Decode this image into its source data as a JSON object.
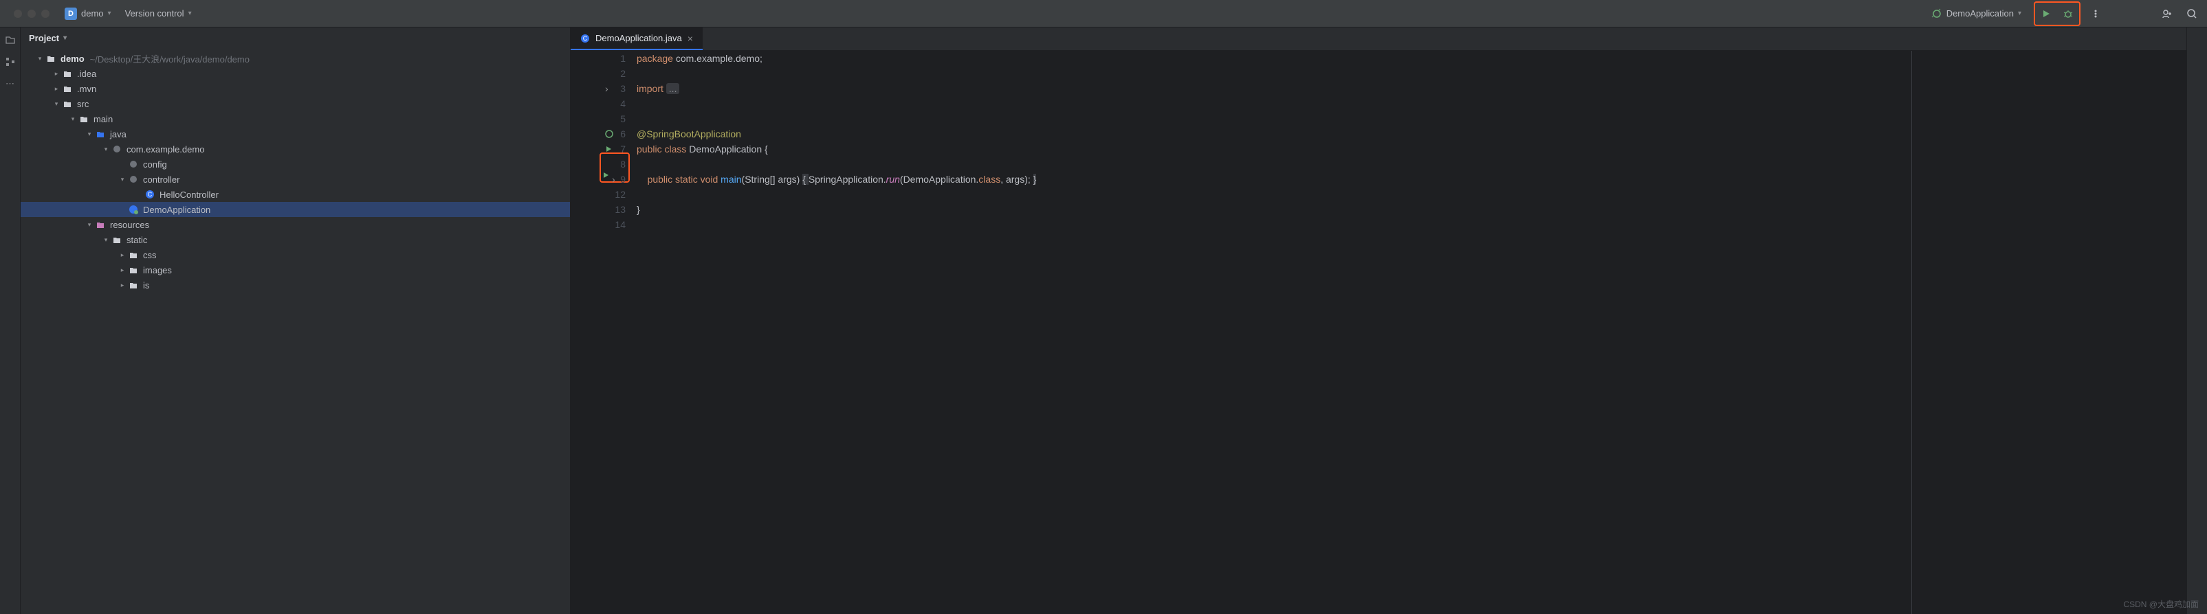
{
  "topbar": {
    "project_badge": "D",
    "project_name": "demo",
    "version_control": "Version control",
    "run_config": "DemoApplication"
  },
  "sidebar": {
    "title": "Project",
    "tree": [
      {
        "d": 0,
        "arrow": "down",
        "icon": "project",
        "label": "demo",
        "bold": true,
        "hint": "~/Desktop/王大浪/work/java/demo/demo"
      },
      {
        "d": 1,
        "arrow": "right",
        "icon": "folder",
        "label": ".idea"
      },
      {
        "d": 1,
        "arrow": "right",
        "icon": "folder",
        "label": ".mvn"
      },
      {
        "d": 1,
        "arrow": "down",
        "icon": "folder",
        "label": "src"
      },
      {
        "d": 2,
        "arrow": "down",
        "icon": "folder",
        "label": "main"
      },
      {
        "d": 3,
        "arrow": "down",
        "icon": "source-folder",
        "label": "java"
      },
      {
        "d": 4,
        "arrow": "down",
        "icon": "package",
        "label": "com.example.demo"
      },
      {
        "d": 5,
        "arrow": "none",
        "icon": "package",
        "label": "config"
      },
      {
        "d": 5,
        "arrow": "down",
        "icon": "package",
        "label": "controller"
      },
      {
        "d": 6,
        "arrow": "none",
        "icon": "class",
        "label": "HelloController"
      },
      {
        "d": 5,
        "arrow": "none",
        "icon": "spring-class",
        "label": "DemoApplication",
        "selected": true
      },
      {
        "d": 3,
        "arrow": "down",
        "icon": "resource-folder",
        "label": "resources"
      },
      {
        "d": 4,
        "arrow": "down",
        "icon": "folder",
        "label": "static"
      },
      {
        "d": 5,
        "arrow": "right",
        "icon": "folder",
        "label": "css"
      },
      {
        "d": 5,
        "arrow": "right",
        "icon": "folder",
        "label": "images"
      },
      {
        "d": 5,
        "arrow": "right",
        "icon": "folder",
        "label": "is"
      }
    ]
  },
  "editor": {
    "tab_name": "DemoApplication.java",
    "lines": [
      "1",
      "2",
      "3",
      "4",
      "5",
      "6",
      "7",
      "8",
      "9",
      "12",
      "13",
      "14"
    ],
    "code": {
      "l1_kw": "package",
      "l1_pkg": " com.example.demo;",
      "l3_kw": "import",
      "l3_fold": "...",
      "l6": "@SpringBootApplication",
      "l7_kw": "public class ",
      "l7_cls": "DemoApplication",
      " l7_brace": " {",
      "l9_pre": "    ",
      "l9_kw": "public static void ",
      "l9_main": "main",
      "l9_sig": "(String[] args) ",
      "l9_br1": "{ ",
      "l9_call": "SpringApplication.",
      "l9_run": "run",
      "l9_args": "(DemoApplication.",
      "l9_class": "class",
      "l9_end": ", args); ",
      "l9_br2": "}",
      "l13": "}"
    }
  },
  "watermark": "CSDN @大盘鸡加面"
}
